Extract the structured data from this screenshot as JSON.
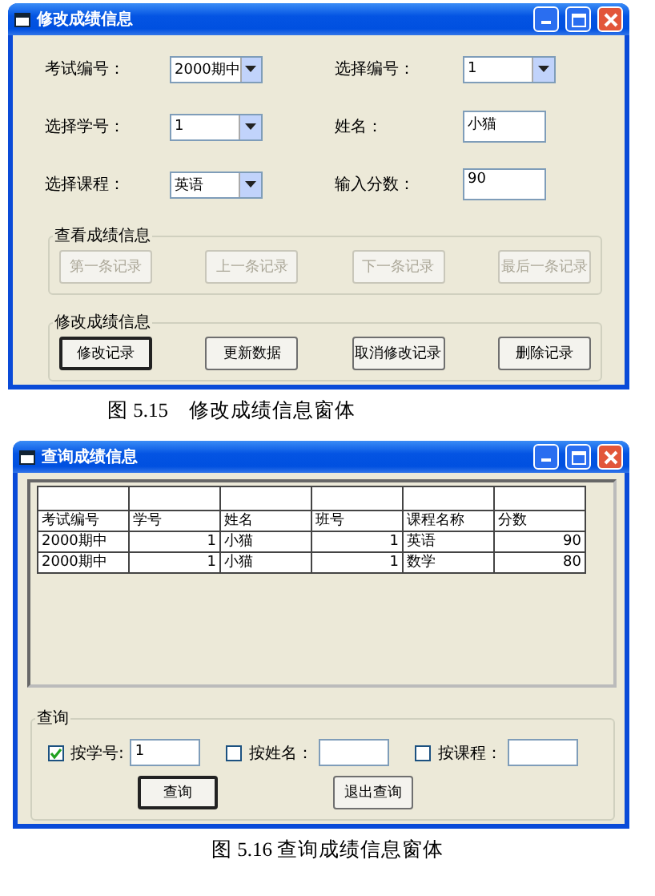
{
  "edit_window": {
    "title": "修改成绩信息",
    "fields": [
      {
        "label": "考试编号：",
        "kind": "combo",
        "value": "2000期中"
      },
      {
        "label": "选择编号：",
        "kind": "combo",
        "value": "1"
      },
      {
        "label": "选择学号：",
        "kind": "combo",
        "value": "1"
      },
      {
        "label": "姓名：",
        "kind": "text",
        "value": "小猫"
      },
      {
        "label": "选择课程：",
        "kind": "combo",
        "value": "英语"
      },
      {
        "label": "输入分数：",
        "kind": "text",
        "value": "90"
      }
    ],
    "groups": [
      {
        "title": "查看成绩信息",
        "buttons": [
          {
            "label": "第一条记录",
            "disabled": true,
            "default": false
          },
          {
            "label": "上一条记录",
            "disabled": true,
            "default": false
          },
          {
            "label": "下一条记录",
            "disabled": true,
            "default": false
          },
          {
            "label": "最后一条记录",
            "disabled": true,
            "default": false
          }
        ]
      },
      {
        "title": "修改成绩信息",
        "buttons": [
          {
            "label": "修改记录",
            "disabled": false,
            "default": true
          },
          {
            "label": "更新数据",
            "disabled": false,
            "default": false
          },
          {
            "label": "取消修改记录",
            "disabled": false,
            "default": false
          },
          {
            "label": "删除记录",
            "disabled": false,
            "default": false
          }
        ]
      }
    ]
  },
  "caption_1": "图 5.15　修改成绩信息窗体",
  "query_window": {
    "title": "查询成绩信息",
    "table": {
      "columns": [
        {
          "label": "考试编号",
          "right_aligned": false
        },
        {
          "label": "学号",
          "right_aligned": true
        },
        {
          "label": "姓名",
          "right_aligned": false
        },
        {
          "label": "班号",
          "right_aligned": true
        },
        {
          "label": "课程名称",
          "right_aligned": false
        },
        {
          "label": "分数",
          "right_aligned": true
        }
      ],
      "rows": [
        [
          "2000期中",
          "1",
          "小猫",
          "1",
          "英语",
          "90"
        ],
        [
          "2000期中",
          "1",
          "小猫",
          "1",
          "数学",
          "80"
        ]
      ]
    },
    "group_title": "查询",
    "filters": [
      {
        "label": "按学号:",
        "checked": true,
        "value": "1"
      },
      {
        "label": "按姓名：",
        "checked": false
      },
      {
        "label": "按课程：",
        "checked": false
      }
    ],
    "buttons": [
      {
        "label": "查询",
        "default": true
      },
      {
        "label": "退出查询",
        "default": false
      }
    ]
  },
  "caption_2": "图 5.16 查询成绩信息窗体"
}
